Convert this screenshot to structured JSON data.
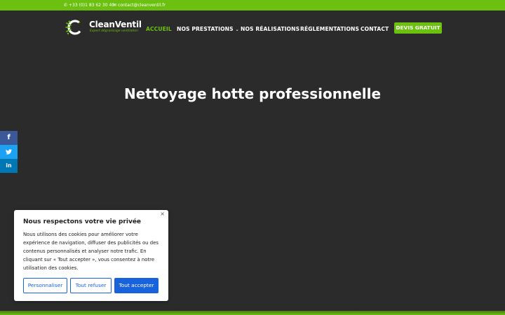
{
  "topbar": {
    "phone_icon": "phone-icon",
    "phone": "+33 (0)1 83 62 30 40",
    "email_icon": "envelope-icon",
    "email": "contact@cleanventil.fr"
  },
  "logo": {
    "name": "CleanVentil",
    "tagline": "Expert dégraissage ventilation"
  },
  "nav": {
    "items": [
      {
        "label": "ACCUEIL",
        "active": true
      },
      {
        "label": "NOS PRESTATIONS",
        "has_dropdown": true
      },
      {
        "label": "NOS RÉALISATIONS"
      },
      {
        "label": "RÉGLEMENTATIONS"
      },
      {
        "label": "CONTACT"
      }
    ],
    "cta": "DEVIS GRATUIT"
  },
  "hero": {
    "title": "Nettoyage hotte professionnelle"
  },
  "social": {
    "facebook": "f",
    "twitter": "twitter-icon",
    "linkedin": "in"
  },
  "cookie_banner": {
    "title": "Nous respectons votre vie privée",
    "body": "Nous utilisons des cookies pour améliorer votre expérience de navigation, diffuser des publicités ou des contenus personnalisés et analyser notre trafic. En cliquant sur « Tout accepter », vous consentez à notre utilisation des cookies.",
    "customize": "Personnaliser",
    "reject": "Tout refuser",
    "accept": "Tout accepter",
    "close": "×"
  },
  "colors": {
    "brand_green": "#6cc110",
    "background": "#2b2b2b",
    "cookie_blue": "#1863dc"
  }
}
